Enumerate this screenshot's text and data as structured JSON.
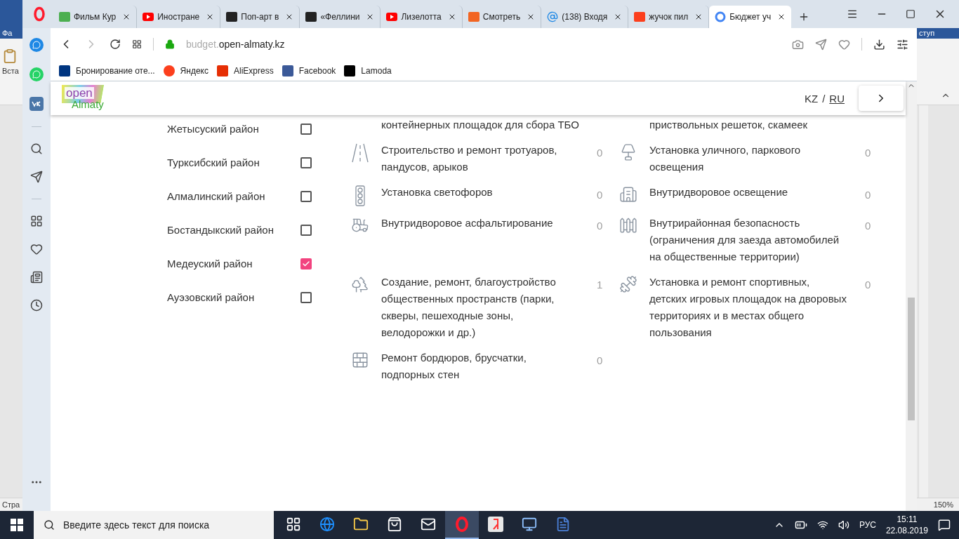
{
  "background_window": {
    "menu_left": "Фа",
    "ribbon_button": "Вста",
    "status_left": "Стра",
    "menu_right": "ступ",
    "zoom": "150%"
  },
  "tabs": [
    {
      "title": "Фильм Кур",
      "selected": false
    },
    {
      "title": "Иностране",
      "selected": false
    },
    {
      "title": "Поп-арт в",
      "selected": false
    },
    {
      "title": "«Феллини",
      "selected": false
    },
    {
      "title": "Лизелотта",
      "selected": false
    },
    {
      "title": "Смотреть",
      "selected": false
    },
    {
      "title": "(138) Входя",
      "selected": false
    },
    {
      "title": "жучок пил",
      "selected": false
    },
    {
      "title": "Бюджет уч",
      "selected": true
    }
  ],
  "address": {
    "subdomain": "budget.",
    "domain": "open-almaty.kz"
  },
  "bookmarks": [
    "Бронирование оте...",
    "Яндекс",
    "AliExpress",
    "Facebook",
    "Lamoda"
  ],
  "site_header": {
    "logo_top": "open",
    "logo_bottom": "Almaty",
    "separator": "/",
    "languages": [
      {
        "label": "KZ",
        "selected": false
      },
      {
        "label": "RU",
        "selected": true
      }
    ]
  },
  "districts": [
    {
      "name": "Жетысуский район",
      "checked": false
    },
    {
      "name": "Турксибский район",
      "checked": false
    },
    {
      "name": "Алмалинский район",
      "checked": false
    },
    {
      "name": "Бостандыкский район",
      "checked": false
    },
    {
      "name": "Медеуский район",
      "checked": true
    },
    {
      "name": "Ауэзовский район",
      "checked": false
    }
  ],
  "categories": [
    {
      "title": "контейнерных площадок для сбора ТБО"
    },
    {
      "title": "приствольных решеток, скамеек"
    },
    {
      "title": "Строительство и ремонт тротуаров, пандусов, арыков",
      "count": "0"
    },
    {
      "title": "Установка уличного, паркового освещения",
      "count": "0"
    },
    {
      "title": "Установка светофоров",
      "count": "0"
    },
    {
      "title": "Внутридворовое освещение",
      "count": "0"
    },
    {
      "title": "Внутридворовое асфальтирование",
      "count": "0"
    },
    {
      "title": "Внутрирайонная безопасность (ограничения для заезда автомобилей на общественные территории)",
      "count": "0"
    },
    {
      "title": "Создание, ремонт, благоустройство общественных пространств (парки, скверы, пешеходные зоны, велодорожки и др.)",
      "count": "1"
    },
    {
      "title": "Установка и ремонт спортивных, детских игровых площадок на дворовых территориях и в местах общего пользования",
      "count": "0"
    },
    {
      "title": "Ремонт бордюров, брусчатки, подпорных стен",
      "count": "0"
    }
  ],
  "taskbar": {
    "search_placeholder": "Введите здесь текст для поиска",
    "apps": [
      {
        "selected": false
      },
      {
        "selected": false
      },
      {
        "selected": false
      },
      {
        "selected": false
      },
      {
        "selected": false
      },
      {
        "selected": true
      },
      {
        "selected": false
      },
      {
        "selected": false
      },
      {
        "selected": false
      }
    ],
    "language": "РУС",
    "time": "15:11",
    "date": "22.08.2019"
  }
}
